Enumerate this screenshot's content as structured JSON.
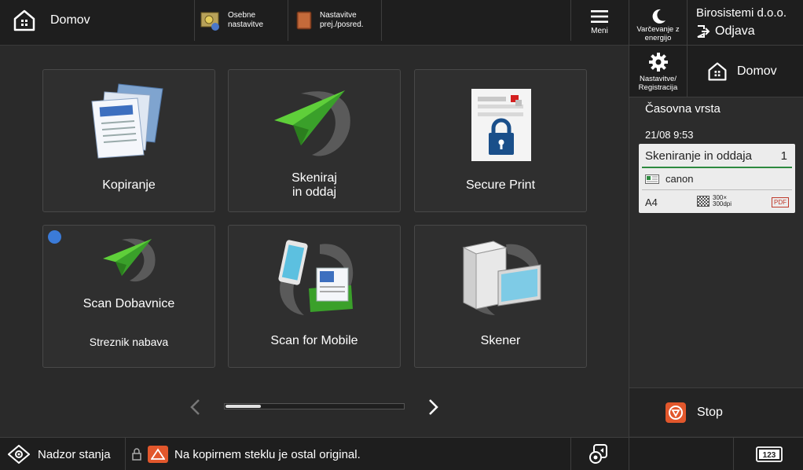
{
  "header": {
    "home_label": "Domov",
    "shortcut1_line1": "Osebne",
    "shortcut1_line2": "nastavitve",
    "shortcut2_line1": "Nastavitve",
    "shortcut2_line2": "prej./posred.",
    "menu_label": "Meni"
  },
  "right_panel": {
    "energy_line1": "Varčevanje z",
    "energy_line2": "energijo",
    "company": "Birosistemi d.o.o.",
    "logout": "Odjava",
    "settings_line1": "Nastavitve/",
    "settings_line2": "Registracija",
    "home_label": "Domov",
    "timeline_title": "Časovna vrsta",
    "timeline_time": "21/08 9:53",
    "job": {
      "title": "Skeniranje in oddaja",
      "count": "1",
      "destination": "canon",
      "size": "A4",
      "dpi_line1": "300×",
      "dpi_line2": "300dpi",
      "format": "PDF"
    },
    "stop_label": "Stop"
  },
  "tiles": {
    "copy": "Kopiranje",
    "scan_send_line1": "Skeniraj",
    "scan_send_line2": "in oddaj",
    "secure_print": "Secure Print",
    "scan_dobavnice": "Scan Dobavnice",
    "scan_dobavnice_sub": "Streznik nabava",
    "scan_mobile": "Scan for Mobile",
    "skener": "Skener"
  },
  "pager": {
    "current_page": 1
  },
  "statusbar": {
    "monitor_label": "Nadzor stanja",
    "message": "Na kopirnem steklu je ostal original.",
    "keypad_label": "123"
  },
  "colors": {
    "accent_green": "#2d8a3f",
    "badge_blue": "#3b7bd8",
    "warning_orange": "#e2572c"
  }
}
